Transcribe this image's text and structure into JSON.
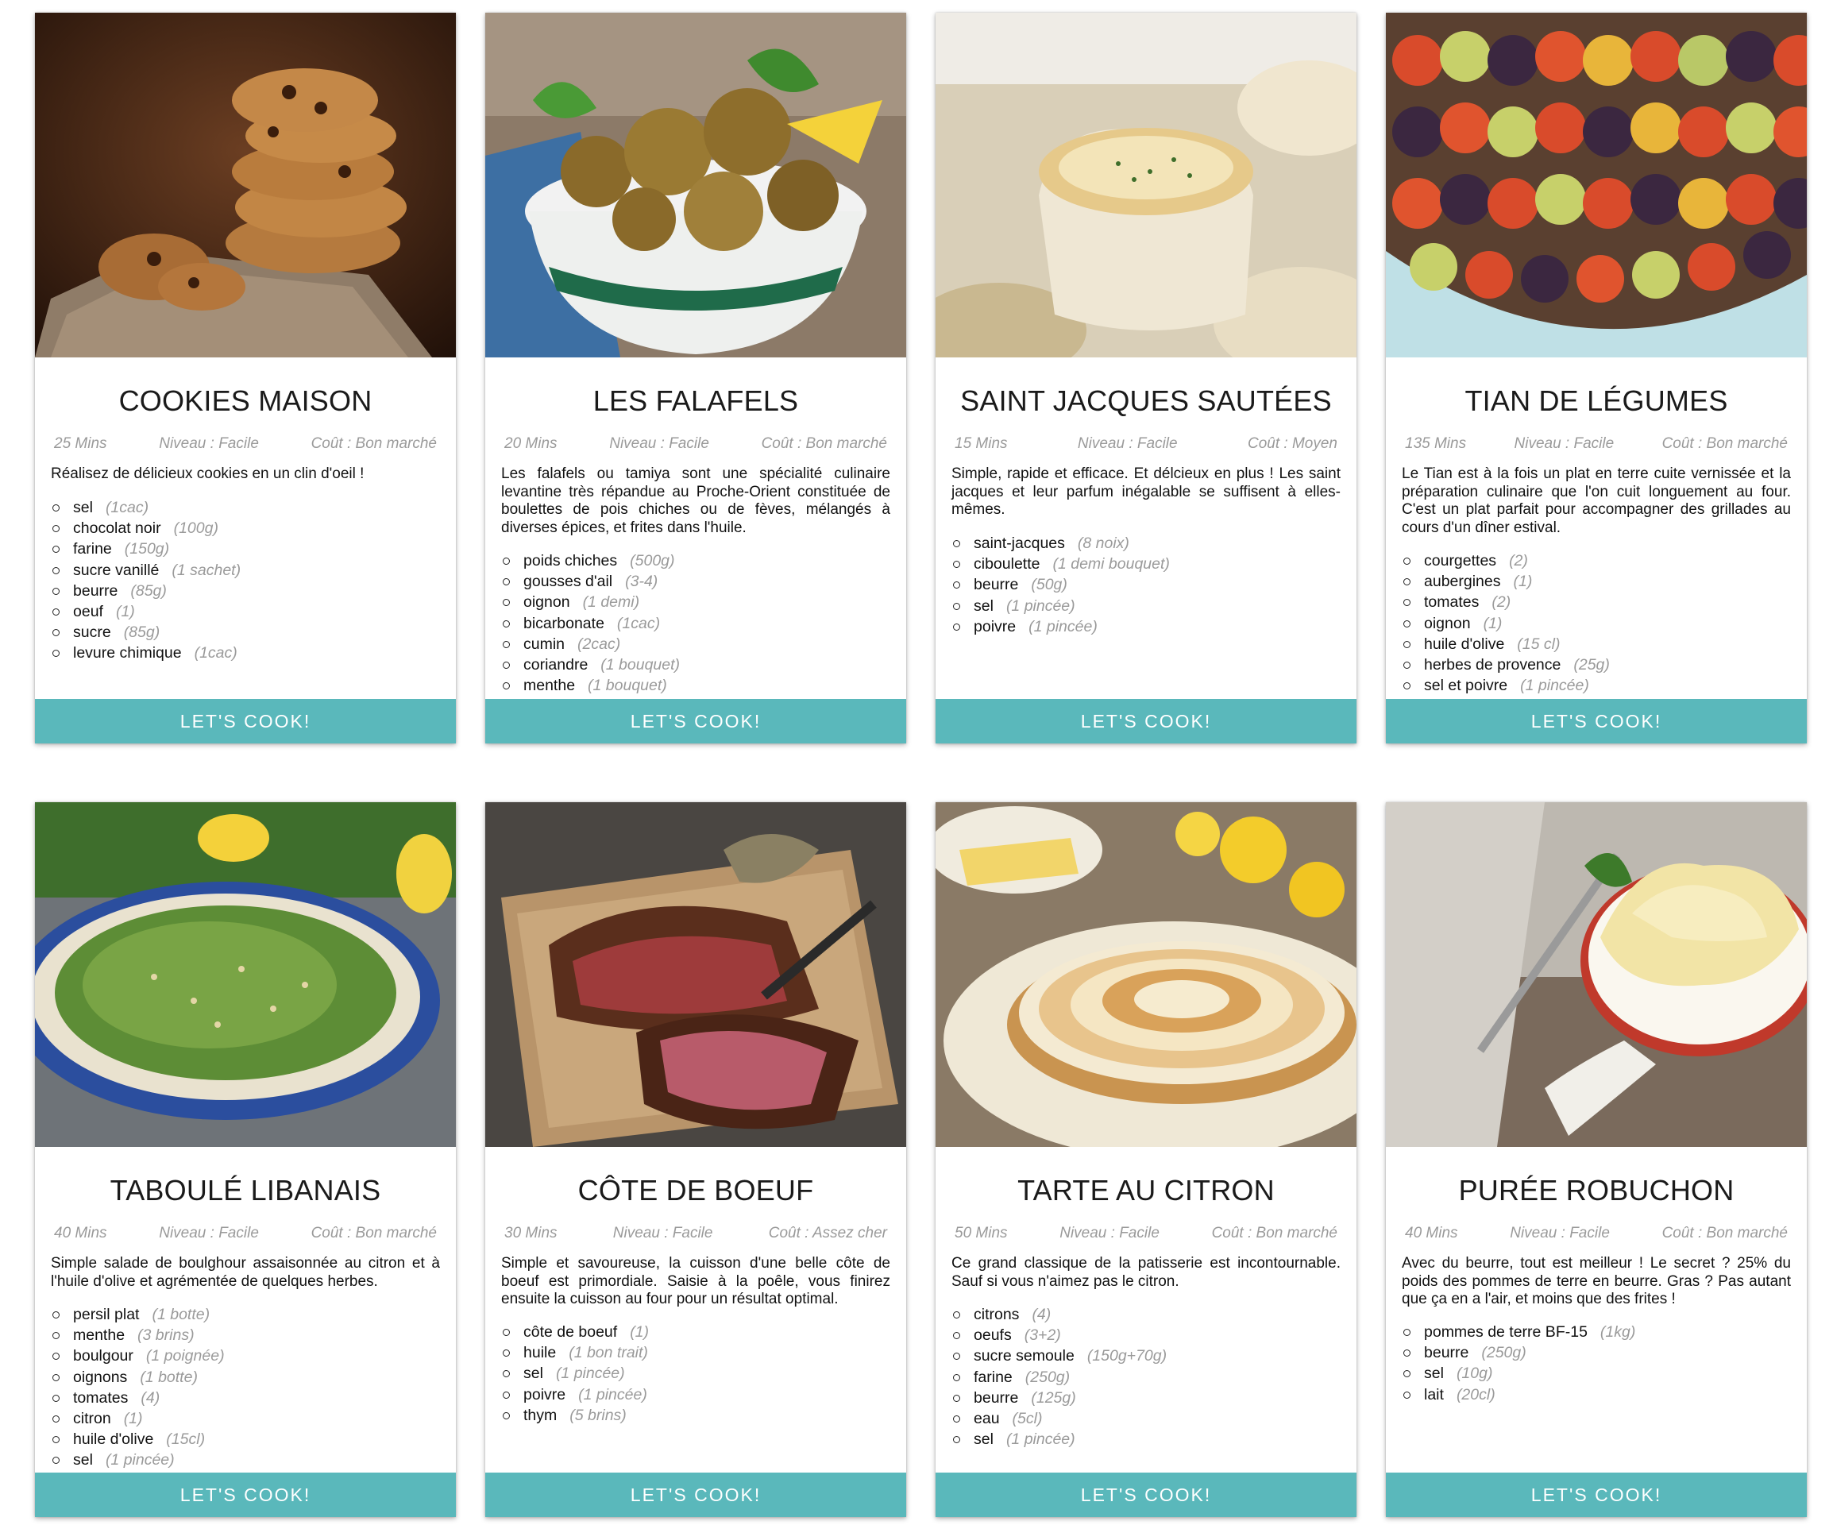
{
  "button_label": "LET'S COOK!",
  "colors": {
    "accent": "#5ab8bb",
    "meta_text": "#9a9a9a"
  },
  "recipes": [
    {
      "title": "COOKIES MAISON",
      "time": "25 Mins",
      "level": "Niveau : Facile",
      "cost": "Coût : Bon marché",
      "description": "Réalisez de délicieux cookies en un clin d'oeil !",
      "ingredients": [
        {
          "name": "sel",
          "qty": "(1cac)"
        },
        {
          "name": "chocolat noir",
          "qty": "(100g)"
        },
        {
          "name": "farine",
          "qty": "(150g)"
        },
        {
          "name": "sucre vanillé",
          "qty": "(1 sachet)"
        },
        {
          "name": "beurre",
          "qty": "(85g)"
        },
        {
          "name": "oeuf",
          "qty": "(1)"
        },
        {
          "name": "sucre",
          "qty": "(85g)"
        },
        {
          "name": "levure chimique",
          "qty": "(1cac)"
        }
      ]
    },
    {
      "title": "LES FALAFELS",
      "time": "20 Mins",
      "level": "Niveau : Facile",
      "cost": "Coût : Bon marché",
      "description": "Les falafels ou tamiya sont une spécialité culinaire levantine très répandue au Proche-Orient constituée de boulettes de pois chiches ou de fèves, mélangés à diverses épices, et frites dans l'huile.",
      "ingredients": [
        {
          "name": "poids chiches",
          "qty": "(500g)"
        },
        {
          "name": "gousses d'ail",
          "qty": "(3-4)"
        },
        {
          "name": "oignon",
          "qty": "(1 demi)"
        },
        {
          "name": "bicarbonate",
          "qty": "(1cac)"
        },
        {
          "name": "cumin",
          "qty": "(2cac)"
        },
        {
          "name": "coriandre",
          "qty": "(1 bouquet)"
        },
        {
          "name": "menthe",
          "qty": "(1 bouquet)"
        }
      ]
    },
    {
      "title": "SAINT JACQUES SAUTÉES",
      "time": "15 Mins",
      "level": "Niveau : Facile",
      "cost": "Coût : Moyen",
      "description": "Simple, rapide et efficace. Et délcieux en plus ! Les saint jacques et leur parfum inégalable se suffisent à elles-mêmes.",
      "ingredients": [
        {
          "name": "saint-jacques",
          "qty": "(8 noix)"
        },
        {
          "name": "ciboulette",
          "qty": "(1 demi bouquet)"
        },
        {
          "name": "beurre",
          "qty": "(50g)"
        },
        {
          "name": "sel",
          "qty": "(1 pincée)"
        },
        {
          "name": "poivre",
          "qty": "(1 pincée)"
        }
      ]
    },
    {
      "title": "TIAN DE LÉGUMES",
      "time": "135 Mins",
      "level": "Niveau : Facile",
      "cost": "Coût : Bon marché",
      "description": "Le Tian est à la fois un plat en terre cuite vernissée et la préparation culinaire que l'on cuit longuement au four. C'est un plat parfait pour accompagner des grillades au cours d'un dîner estival.",
      "ingredients": [
        {
          "name": "courgettes",
          "qty": "(2)"
        },
        {
          "name": "aubergines",
          "qty": "(1)"
        },
        {
          "name": "tomates",
          "qty": "(2)"
        },
        {
          "name": "oignon",
          "qty": "(1)"
        },
        {
          "name": "huile d'olive",
          "qty": "(15 cl)"
        },
        {
          "name": "herbes de provence",
          "qty": "(25g)"
        },
        {
          "name": "sel et poivre",
          "qty": "(1 pincée)"
        }
      ]
    },
    {
      "title": "TABOULÉ LIBANAIS",
      "time": "40 Mins",
      "level": "Niveau : Facile",
      "cost": "Coût : Bon marché",
      "description": "Simple salade de boulghour assaisonnée au citron et à l'huile d'olive et agrémentée de quelques herbes.",
      "ingredients": [
        {
          "name": "persil plat",
          "qty": "(1 botte)"
        },
        {
          "name": "menthe",
          "qty": "(3 brins)"
        },
        {
          "name": "boulgour",
          "qty": "(1 poignée)"
        },
        {
          "name": "oignons",
          "qty": "(1 botte)"
        },
        {
          "name": "tomates",
          "qty": "(4)"
        },
        {
          "name": "citron",
          "qty": "(1)"
        },
        {
          "name": "huile d'olive",
          "qty": "(15cl)"
        },
        {
          "name": "sel",
          "qty": "(1 pincée)"
        }
      ]
    },
    {
      "title": "CÔTE DE BOEUF",
      "time": "30 Mins",
      "level": "Niveau : Facile",
      "cost": "Coût : Assez cher",
      "description": "Simple et savoureuse, la cuisson d'une belle côte de boeuf est primordiale. Saisie à la poêle, vous finirez ensuite la cuisson au four pour un résultat optimal.",
      "ingredients": [
        {
          "name": "côte de boeuf",
          "qty": "(1)"
        },
        {
          "name": "huile",
          "qty": "(1 bon trait)"
        },
        {
          "name": "sel",
          "qty": "(1 pincée)"
        },
        {
          "name": "poivre",
          "qty": "(1 pincée)"
        },
        {
          "name": "thym",
          "qty": "(5 brins)"
        }
      ]
    },
    {
      "title": "TARTE AU CITRON",
      "time": "50 Mins",
      "level": "Niveau : Facile",
      "cost": "Coût : Bon marché",
      "description": "Ce grand classique de la patisserie est incontournable. Sauf si vous n'aimez pas le citron.",
      "ingredients": [
        {
          "name": "citrons",
          "qty": "(4)"
        },
        {
          "name": "oeufs",
          "qty": "(3+2)"
        },
        {
          "name": "sucre semoule",
          "qty": "(150g+70g)"
        },
        {
          "name": "farine",
          "qty": "(250g)"
        },
        {
          "name": "beurre",
          "qty": "(125g)"
        },
        {
          "name": "eau",
          "qty": "(5cl)"
        },
        {
          "name": "sel",
          "qty": "(1 pincée)"
        }
      ]
    },
    {
      "title": "PURÉE ROBUCHON",
      "time": "40 Mins",
      "level": "Niveau : Facile",
      "cost": "Coût : Bon marché",
      "description": "Avec du beurre, tout est meilleur ! Le secret ? 25% du poids des pommes de terre en beurre. Gras ? Pas autant que ça en a l'air, et moins que des frites !",
      "ingredients": [
        {
          "name": "pommes de terre BF-15",
          "qty": "(1kg)"
        },
        {
          "name": "beurre",
          "qty": "(250g)"
        },
        {
          "name": "sel",
          "qty": "(10g)"
        },
        {
          "name": "lait",
          "qty": "(20cl)"
        }
      ]
    }
  ]
}
